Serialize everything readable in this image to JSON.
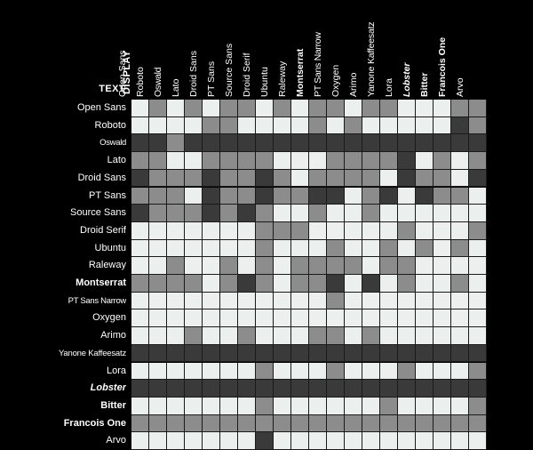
{
  "axes": {
    "display_label": "DISPLAY",
    "text_label": "TEXT"
  },
  "colors": {
    "background": "#000000",
    "label": "#ffffff",
    "gridline": "#1a1a1a",
    "scale_light": "#ebefee",
    "scale_mid_light": "#c8cccb",
    "scale_mid": "#8c8c8c",
    "scale_mid_dark": "#6e6e6e",
    "scale_dark": "#3a3a3a"
  },
  "chart_data": {
    "type": "heatmap",
    "title": "",
    "xlabel": "DISPLAY",
    "ylabel": "TEXT",
    "legend": "",
    "grid": true,
    "value_scale": [
      0,
      1,
      2,
      3
    ],
    "scale_colors": [
      "#3a3a3a",
      "#6e6e6e",
      "#8c8c8c",
      "#ebefee"
    ],
    "categories": [
      "Open Sans",
      "Roboto",
      "Oswald",
      "Lato",
      "Droid Sans",
      "PT Sans",
      "Source Sans",
      "Droid Serif",
      "Ubuntu",
      "Raleway",
      "Montserrat",
      "PT Sans Narrow",
      "Oxygen",
      "Arimo",
      "Yanone Kaffeesatz",
      "Lora",
      "Lobster",
      "Bitter",
      "Francois One",
      "Arvo"
    ],
    "columns": [
      {
        "label": "Open Sans",
        "style": "normal"
      },
      {
        "label": "Roboto",
        "style": "normal"
      },
      {
        "label": "Oswald",
        "style": "narrow"
      },
      {
        "label": "Lato",
        "style": "normal"
      },
      {
        "label": "Droid Sans",
        "style": "normal"
      },
      {
        "label": "PT Sans",
        "style": "normal"
      },
      {
        "label": "Source Sans",
        "style": "normal"
      },
      {
        "label": "Droid Serif",
        "style": "normal"
      },
      {
        "label": "Ubuntu",
        "style": "normal"
      },
      {
        "label": "Raleway",
        "style": "normal"
      },
      {
        "label": "Montserrat",
        "style": "bold"
      },
      {
        "label": "PT Sans Narrow",
        "style": "narrow"
      },
      {
        "label": "Oxygen",
        "style": "normal"
      },
      {
        "label": "Arimo",
        "style": "normal"
      },
      {
        "label": "Yanone Kaffeesatz",
        "style": "condensed"
      },
      {
        "label": "Lora",
        "style": "normal"
      },
      {
        "label": "Lobster",
        "style": "script"
      },
      {
        "label": "Bitter",
        "style": "bold"
      },
      {
        "label": "Francois One",
        "style": "bold"
      },
      {
        "label": "Arvo",
        "style": "normal"
      }
    ],
    "rows": [
      {
        "label": "Open Sans",
        "style": "normal",
        "values": [
          3,
          2,
          3,
          2,
          3,
          2,
          2,
          3,
          2,
          3,
          2,
          2,
          3,
          2,
          2,
          3,
          3,
          3,
          2,
          2
        ]
      },
      {
        "label": "Roboto",
        "style": "normal",
        "values": [
          3,
          3,
          3,
          3,
          2,
          2,
          3,
          3,
          3,
          3,
          2,
          3,
          2,
          3,
          3,
          3,
          3,
          3,
          0,
          2
        ]
      },
      {
        "label": "Oswald",
        "style": "narrow",
        "values": [
          0,
          0,
          2,
          0,
          0,
          0,
          0,
          0,
          0,
          0,
          0,
          0,
          0,
          0,
          0,
          0,
          0,
          0,
          0,
          0
        ]
      },
      {
        "label": "Lato",
        "style": "normal",
        "values": [
          2,
          2,
          3,
          3,
          2,
          2,
          2,
          2,
          3,
          3,
          3,
          2,
          2,
          2,
          2,
          0,
          3,
          2,
          3,
          2
        ]
      },
      {
        "label": "Droid Sans",
        "style": "normal",
        "values": [
          0,
          2,
          2,
          2,
          0,
          2,
          2,
          0,
          2,
          3,
          2,
          2,
          2,
          2,
          3,
          0,
          2,
          2,
          3,
          0
        ]
      },
      {
        "label": "PT Sans",
        "style": "normal",
        "values": [
          2,
          2,
          2,
          3,
          0,
          2,
          2,
          0,
          2,
          2,
          0,
          0,
          3,
          2,
          0,
          3,
          0,
          2,
          2,
          3
        ]
      },
      {
        "label": "Source Sans",
        "style": "normal",
        "values": [
          0,
          2,
          2,
          2,
          0,
          2,
          0,
          2,
          3,
          3,
          2,
          3,
          3,
          2,
          3,
          3,
          3,
          3,
          3,
          3
        ]
      },
      {
        "label": "Droid Serif",
        "style": "normal",
        "values": [
          3,
          3,
          3,
          3,
          3,
          3,
          3,
          2,
          2,
          2,
          3,
          3,
          3,
          3,
          3,
          2,
          3,
          3,
          3,
          2
        ]
      },
      {
        "label": "Ubuntu",
        "style": "normal",
        "values": [
          3,
          3,
          3,
          3,
          3,
          3,
          3,
          2,
          3,
          3,
          3,
          2,
          3,
          3,
          2,
          3,
          2,
          3,
          2,
          3
        ]
      },
      {
        "label": "Raleway",
        "style": "normal",
        "values": [
          3,
          3,
          2,
          3,
          3,
          2,
          3,
          2,
          3,
          2,
          2,
          2,
          2,
          3,
          2,
          2,
          3,
          3,
          3,
          3
        ]
      },
      {
        "label": "Montserrat",
        "style": "bold",
        "values": [
          2,
          2,
          2,
          2,
          3,
          2,
          0,
          2,
          3,
          2,
          2,
          0,
          3,
          0,
          3,
          2,
          3,
          3,
          2,
          3
        ]
      },
      {
        "label": "PT Sans Narrow",
        "style": "narrow",
        "values": [
          3,
          3,
          3,
          3,
          3,
          3,
          3,
          3,
          3,
          3,
          3,
          2,
          3,
          3,
          3,
          3,
          3,
          3,
          3,
          3
        ]
      },
      {
        "label": "Oxygen",
        "style": "normal",
        "values": [
          3,
          3,
          3,
          3,
          3,
          3,
          3,
          3,
          3,
          3,
          3,
          3,
          3,
          3,
          3,
          3,
          3,
          3,
          3,
          3
        ]
      },
      {
        "label": "Arimo",
        "style": "normal",
        "values": [
          3,
          3,
          3,
          2,
          3,
          3,
          2,
          3,
          3,
          3,
          2,
          2,
          3,
          2,
          3,
          3,
          3,
          3,
          3,
          3
        ]
      },
      {
        "label": "Yanone Kaffeesatz",
        "style": "condensed",
        "values": [
          0,
          0,
          0,
          0,
          0,
          0,
          0,
          0,
          0,
          0,
          0,
          0,
          0,
          0,
          0,
          0,
          0,
          0,
          0,
          0
        ]
      },
      {
        "label": "Lora",
        "style": "normal",
        "values": [
          3,
          3,
          3,
          3,
          3,
          3,
          3,
          2,
          3,
          3,
          3,
          2,
          3,
          3,
          3,
          2,
          3,
          3,
          3,
          2
        ]
      },
      {
        "label": "Lobster",
        "style": "script",
        "values": [
          0,
          0,
          0,
          0,
          0,
          0,
          0,
          0,
          0,
          0,
          0,
          0,
          0,
          0,
          0,
          0,
          0,
          0,
          0,
          0
        ]
      },
      {
        "label": "Bitter",
        "style": "bold",
        "values": [
          3,
          3,
          3,
          3,
          3,
          3,
          3,
          2,
          3,
          3,
          3,
          3,
          3,
          3,
          2,
          3,
          3,
          3,
          3,
          2
        ]
      },
      {
        "label": "Francois One",
        "style": "bold",
        "values": [
          2,
          2,
          2,
          2,
          2,
          2,
          2,
          2,
          2,
          2,
          2,
          2,
          2,
          2,
          2,
          2,
          2,
          2,
          2,
          2
        ]
      },
      {
        "label": "Arvo",
        "style": "normal",
        "values": [
          3,
          3,
          3,
          3,
          3,
          3,
          3,
          0,
          3,
          3,
          3,
          3,
          3,
          3,
          3,
          3,
          3,
          3,
          3,
          3
        ]
      }
    ]
  }
}
